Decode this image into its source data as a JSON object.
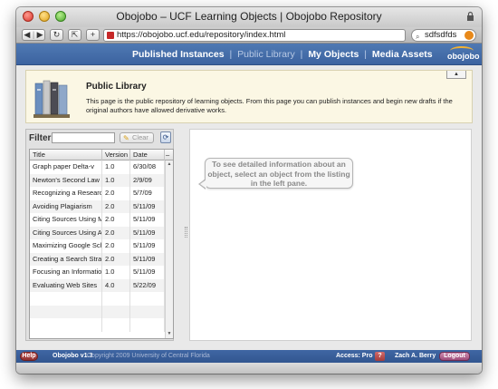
{
  "window": {
    "title": "Obojobo – UCF Learning Objects | Obojobo Repository"
  },
  "browser": {
    "url": "https://obojobo.ucf.edu/repository/index.html",
    "search_value": "sdfsdfds"
  },
  "nav": {
    "published": "Published Instances",
    "sep1": "|",
    "library": "Public Library",
    "sep2": "|",
    "my_objects": "My Objects",
    "sep3": "|",
    "media": "Media Assets",
    "logo_text": "obojobo"
  },
  "header": {
    "title": "Public Library",
    "description": "This page is the public repository of learning objects.  From this page you can publish instances and begin new drafts if the original authors have allowed derivative works."
  },
  "filter": {
    "label": "Filter:",
    "value": "",
    "clear_label": "Clear"
  },
  "grid": {
    "columns": [
      "Title",
      "Version",
      "Date",
      "–"
    ],
    "rows": [
      {
        "title": "Graph paper Delta-v",
        "version": "1.0",
        "date": "6/30/08"
      },
      {
        "title": "Newton's Second Law of",
        "version": "1.0",
        "date": "2/9/09"
      },
      {
        "title": "Recognizing a Research",
        "version": "2.0",
        "date": "5/7/09"
      },
      {
        "title": "Avoiding Plagiarism",
        "version": "2.0",
        "date": "5/11/09"
      },
      {
        "title": "Citing Sources Using ML",
        "version": "2.0",
        "date": "5/11/09"
      },
      {
        "title": "Citing Sources Using AP",
        "version": "2.0",
        "date": "5/11/09"
      },
      {
        "title": "Maximizing Google Schol",
        "version": "2.0",
        "date": "5/11/09"
      },
      {
        "title": "Creating a Search Strateg",
        "version": "2.0",
        "date": "5/11/09"
      },
      {
        "title": "Focusing an Information",
        "version": "1.0",
        "date": "5/11/09"
      },
      {
        "title": "Evaluating Web Sites",
        "version": "4.0",
        "date": "5/22/09"
      }
    ]
  },
  "detail": {
    "hint": "To see detailed information about an object, select an object from the listing in the left pane."
  },
  "footer": {
    "help": "Help",
    "version": "Obojobo v1.3",
    "copyright": "Copyright 2009 University of Central Florida",
    "access": "Access: Pro",
    "question": "?",
    "user": "Zach A. Berry",
    "logout": "Logout"
  }
}
